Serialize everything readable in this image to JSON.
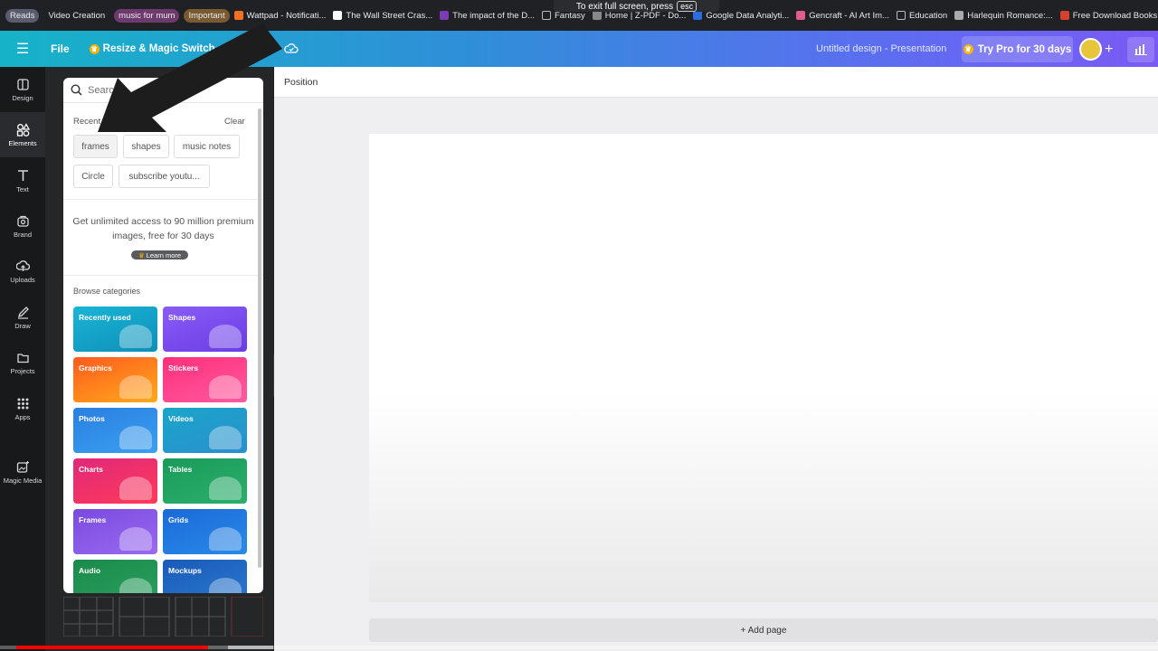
{
  "bookmarks": {
    "chips": [
      {
        "label": "Reads",
        "color": "#5b5b6e"
      },
      {
        "label": "Video Creation",
        "color": "#202124"
      },
      {
        "label": "music for mum",
        "color": "#6e3a6e"
      },
      {
        "label": "Important",
        "color": "#7a5a30"
      }
    ],
    "items": [
      {
        "label": "Wattpad - Notificati...",
        "icon_color": "#f5711f"
      },
      {
        "label": "The Wall Street Cras...",
        "icon_color": "#ffffff"
      },
      {
        "label": "The impact of the D...",
        "icon_color": "#7a3bb5"
      },
      {
        "label": "Fantasy",
        "icon_color": "folder"
      },
      {
        "label": "Home | Z-PDF - Do...",
        "icon_color": "#888888"
      },
      {
        "label": "Google Data Analyti...",
        "icon_color": "#2d6be0"
      },
      {
        "label": "Gencraft - AI Art Im...",
        "icon_color": "#e05f8a"
      },
      {
        "label": "Education",
        "icon_color": "folder"
      },
      {
        "label": "Harlequin Romance:...",
        "icon_color": "#aaaaaa"
      },
      {
        "label": "Free Download Books",
        "icon_color": "#d8402e"
      }
    ]
  },
  "fullscreen_notice": {
    "text": "To exit full screen, press",
    "key": "esc"
  },
  "topbar": {
    "file": "File",
    "resize": "Resize & Magic Switch",
    "title": "Untitled design - Presentation",
    "pro": "Try Pro for 30 days"
  },
  "rail": [
    {
      "label": "Design",
      "icon": "design-icon"
    },
    {
      "label": "Elements",
      "icon": "elements-icon",
      "active": true
    },
    {
      "label": "Text",
      "icon": "text-icon"
    },
    {
      "label": "Brand",
      "icon": "brand-icon"
    },
    {
      "label": "Uploads",
      "icon": "uploads-icon"
    },
    {
      "label": "Draw",
      "icon": "draw-icon"
    },
    {
      "label": "Projects",
      "icon": "projects-icon"
    },
    {
      "label": "Apps",
      "icon": "apps-icon"
    },
    {
      "label": "Magic Media",
      "icon": "magic-media-icon"
    }
  ],
  "panel": {
    "search_placeholder": "Search",
    "recent_label": "Recent",
    "clear_label": "Clear",
    "recent_tags": [
      "frames",
      "shapes",
      "music notes",
      "Circle",
      "subscribe youtu..."
    ],
    "promo_text": "Get unlimited access to 90 million premium images, free for 30 days",
    "learn_more": "Learn more",
    "browse_label": "Browse categories",
    "categories": [
      {
        "label": "Recently used",
        "color_a": "#19b5d6",
        "color_b": "#0f8fb8"
      },
      {
        "label": "Shapes",
        "color_a": "#8a5cf6",
        "color_b": "#6b3de6"
      },
      {
        "label": "Graphics",
        "color_a": "#ff5a1f",
        "color_b": "#ffaa1a"
      },
      {
        "label": "Stickers",
        "color_a": "#ff2f7a",
        "color_b": "#ff5aa0"
      },
      {
        "label": "Photos",
        "color_a": "#2a7fe0",
        "color_b": "#3aa0f0"
      },
      {
        "label": "Videos",
        "color_a": "#1aa6c8",
        "color_b": "#2a8fd0"
      },
      {
        "label": "Charts",
        "color_a": "#e0287a",
        "color_b": "#ff3a5a"
      },
      {
        "label": "Tables",
        "color_a": "#1a9a5a",
        "color_b": "#2ab06a"
      },
      {
        "label": "Frames",
        "color_a": "#7a4ae0",
        "color_b": "#9a6af0"
      },
      {
        "label": "Grids",
        "color_a": "#1a6ad8",
        "color_b": "#2a8ae8"
      },
      {
        "label": "Audio",
        "color_a": "#1a8a4a",
        "color_b": "#2aa060"
      },
      {
        "label": "Mockups",
        "color_a": "#1a5ab8",
        "color_b": "#2a7ad0"
      }
    ]
  },
  "canvas": {
    "position_label": "Position",
    "add_page": "+ Add page"
  },
  "video_progress": 0.18
}
